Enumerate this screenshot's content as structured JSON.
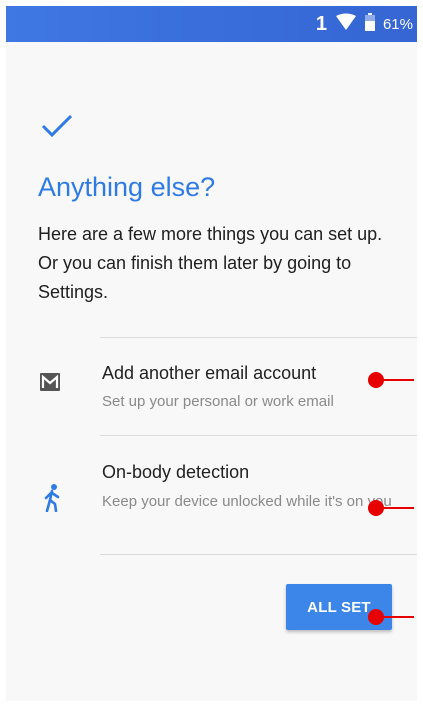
{
  "status_bar": {
    "signal_number": "1",
    "wifi_icon": "wifi-icon",
    "battery_icon": "battery-icon",
    "battery_percent": "61%"
  },
  "header": {
    "check_icon": "check-icon",
    "title": "Anything else?",
    "description": "Here are a few more things you can set up. Or you can finish them later by going to Settings."
  },
  "options": [
    {
      "icon": "email-icon",
      "title": "Add another email account",
      "subtitle": "Set up your personal or work email"
    },
    {
      "icon": "walking-person-icon",
      "title": "On-body detection",
      "subtitle": "Keep your device unlocked while it's on you"
    }
  ],
  "actions": {
    "all_set_label": "ALL SET"
  },
  "colors": {
    "accent": "#2f7be6",
    "button": "#3b86e8",
    "status_bar": "#3a6fdb",
    "marker": "#e60000"
  }
}
